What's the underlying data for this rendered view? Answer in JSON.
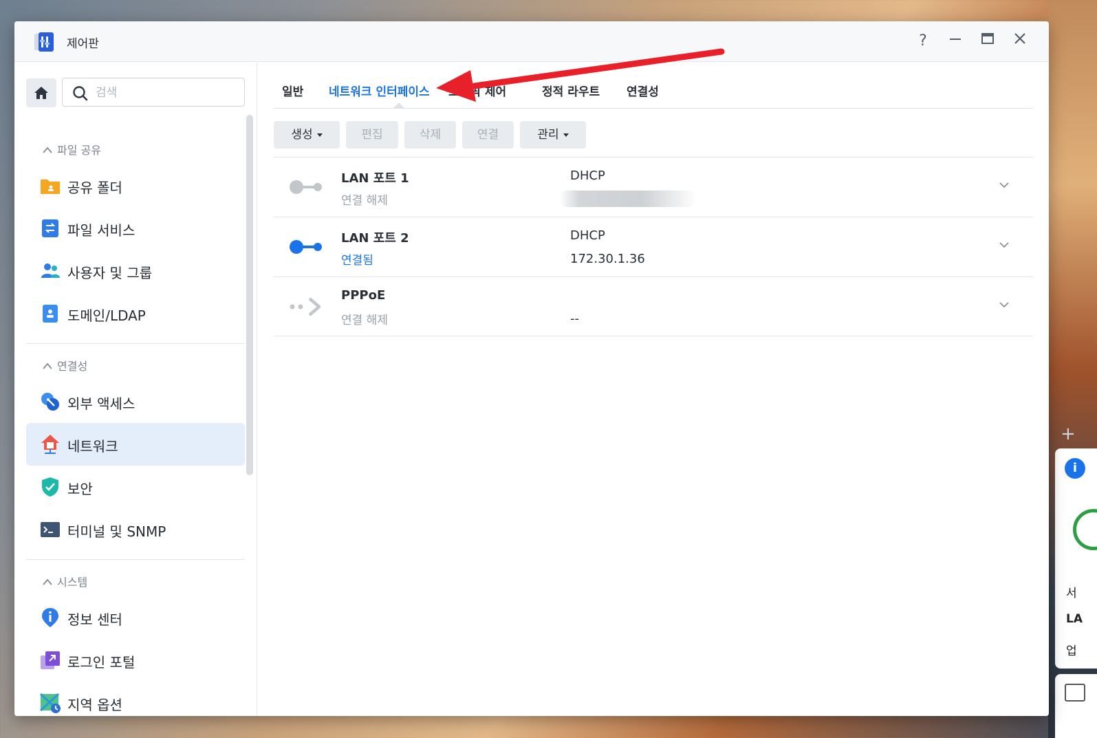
{
  "window": {
    "title": "제어판",
    "controls": {
      "help": "?",
      "minimize": "—",
      "maximize": "▭",
      "close": "✕"
    }
  },
  "sidebar": {
    "search_placeholder": "검색",
    "sections": [
      {
        "header": "파일 공유",
        "items": [
          {
            "label": "공유 폴더",
            "icon": "shared-folder-icon"
          },
          {
            "label": "파일 서비스",
            "icon": "file-services-icon"
          },
          {
            "label": "사용자 및 그룹",
            "icon": "users-groups-icon"
          },
          {
            "label": "도메인/LDAP",
            "icon": "domain-ldap-icon"
          }
        ]
      },
      {
        "header": "연결성",
        "items": [
          {
            "label": "외부 액세스",
            "icon": "external-access-icon"
          },
          {
            "label": "네트워크",
            "icon": "network-icon",
            "active": true
          },
          {
            "label": "보안",
            "icon": "security-shield-icon"
          },
          {
            "label": "터미널 및 SNMP",
            "icon": "terminal-icon"
          }
        ]
      },
      {
        "header": "시스템",
        "items": [
          {
            "label": "정보 센터",
            "icon": "info-center-icon"
          },
          {
            "label": "로그인 포털",
            "icon": "login-portal-icon"
          },
          {
            "label": "지역 옵션",
            "icon": "regional-options-icon"
          }
        ]
      }
    ]
  },
  "tabs": [
    {
      "label": "일반"
    },
    {
      "label": "네트워크 인터페이스",
      "active": true
    },
    {
      "label": "트래픽 제어"
    },
    {
      "label": "정적 라우트"
    },
    {
      "label": "연결성"
    }
  ],
  "toolbar": {
    "create": "생성",
    "edit": "편집",
    "delete": "삭제",
    "connect": "연결",
    "manage": "관리"
  },
  "interfaces": [
    {
      "name": "LAN 포트 1",
      "status": "연결 해제",
      "mode": "DHCP",
      "address": "",
      "connected": false
    },
    {
      "name": "LAN 포트 2",
      "status": "연결됨",
      "mode": "DHCP",
      "address": "172.30.1.36",
      "connected": true
    },
    {
      "name": "PPPoE",
      "status": "연결 해제",
      "mode": "",
      "address": "--",
      "connected": false
    }
  ],
  "colors": {
    "accent": "#1a73e8",
    "annotation": "#e8202a",
    "active_bg": "#e4eefa"
  },
  "side_widget": {
    "plus": "+",
    "info": "i",
    "line1": "서",
    "line2": "LA",
    "line3": "업"
  }
}
